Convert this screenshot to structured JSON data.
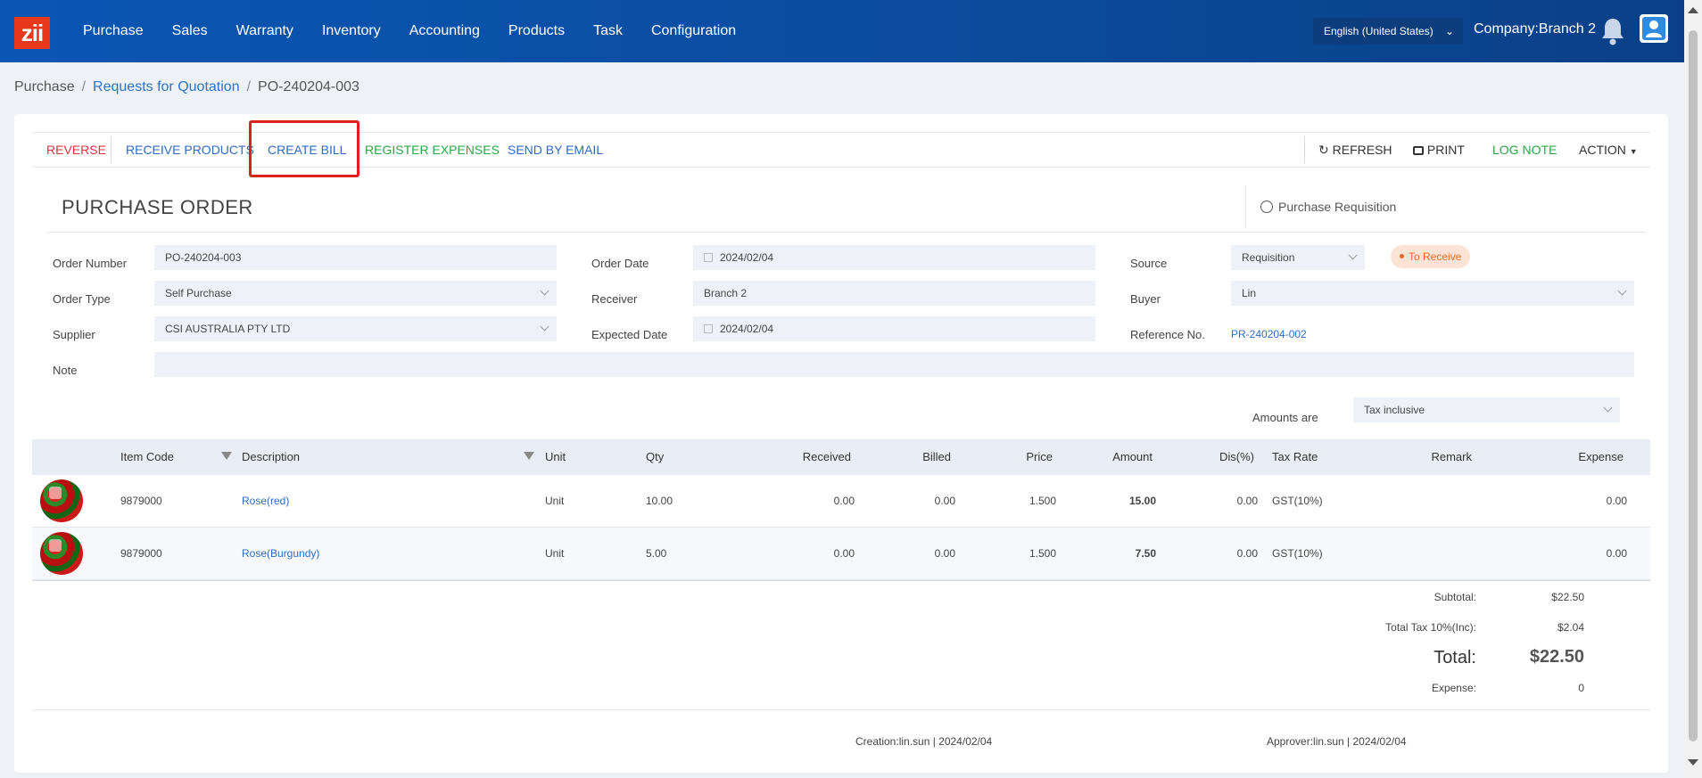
{
  "app": {
    "logo_text": "zii",
    "menu": [
      "Purchase",
      "Sales",
      "Warranty",
      "Inventory",
      "Accounting",
      "Products",
      "Task",
      "Configuration"
    ],
    "language": "English (United States)",
    "company": "Company:Branch 2"
  },
  "breadcrumb": {
    "root": "Purchase",
    "parent": "Requests for Quotation",
    "current": "PO-240204-003"
  },
  "toolbar": {
    "reverse": "REVERSE",
    "receive_products": "RECEIVE PRODUCTS",
    "create_bill": "CREATE BILL",
    "register_expenses": "REGISTER EXPENSES",
    "send_by_email": "SEND BY EMAIL",
    "refresh": "REFRESH",
    "print": "PRINT",
    "log_note": "LOG NOTE",
    "action": "ACTION"
  },
  "form": {
    "title": "PURCHASE ORDER",
    "purchase_requisition": "Purchase Requisition",
    "order_number_label": "Order Number",
    "order_number": "PO-240204-003",
    "order_type_label": "Order Type",
    "order_type": "Self Purchase",
    "supplier_label": "Supplier",
    "supplier": "CSI AUSTRALIA PTY LTD",
    "note_label": "Note",
    "note": "",
    "order_date_label": "Order Date",
    "order_date": "2024/02/04",
    "receiver_label": "Receiver",
    "receiver": "Branch 2",
    "expected_date_label": "Expected Date",
    "expected_date": "2024/02/04",
    "source_label": "Source",
    "source": "Requisition",
    "status": "To Receive",
    "buyer_label": "Buyer",
    "buyer": "Lin",
    "reference_label": "Reference No.",
    "reference": "PR-240204-002",
    "amounts_label": "Amounts are",
    "amounts": "Tax inclusive"
  },
  "table": {
    "headers": {
      "item_code": "Item Code",
      "description": "Description",
      "unit": "Unit",
      "qty": "Qty",
      "received": "Received",
      "billed": "Billed",
      "price": "Price",
      "amount": "Amount",
      "dis": "Dis(%)",
      "tax_rate": "Tax Rate",
      "remark": "Remark",
      "expense": "Expense"
    },
    "rows": [
      {
        "item_code": "9879000",
        "description": "Rose(red)",
        "unit": "Unit",
        "qty": "10.00",
        "received": "0.00",
        "billed": "0.00",
        "price": "1.500",
        "amount": "15.00",
        "dis": "0.00",
        "tax_rate": "GST(10%)",
        "remark": "",
        "expense": "0.00"
      },
      {
        "item_code": "9879000",
        "description": "Rose(Burgundy)",
        "unit": "Unit",
        "qty": "5.00",
        "received": "0.00",
        "billed": "0.00",
        "price": "1.500",
        "amount": "7.50",
        "dis": "0.00",
        "tax_rate": "GST(10%)",
        "remark": "",
        "expense": "0.00"
      }
    ]
  },
  "totals": {
    "subtotal_label": "Subtotal:",
    "subtotal": "$22.50",
    "tax_label": "Total Tax 10%(Inc):",
    "tax": "$2.04",
    "total_label": "Total:",
    "total": "$22.50",
    "expense_label": "Expense:",
    "expense": "0"
  },
  "footer": {
    "creation": "Creation:lin.sun | 2024/02/04",
    "approver": "Approver:lin.sun | 2024/02/04"
  },
  "colors": {
    "nav_bg": "#0b4c9e",
    "link_blue": "#2d6bc4",
    "reverse_red": "#d9363e",
    "green": "#28a745",
    "status_orange": "#e76b2d",
    "highlight_red": "#e01f1f"
  }
}
